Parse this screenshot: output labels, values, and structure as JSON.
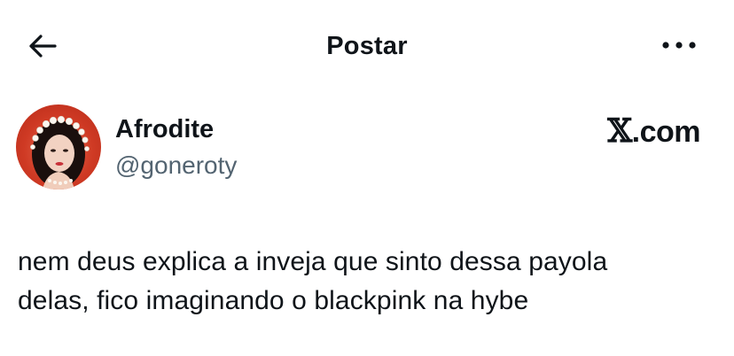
{
  "header": {
    "title": "Postar",
    "back_icon": "arrow-left-icon",
    "more_icon": "more-horizontal-icon"
  },
  "author": {
    "display_name": "Afrodite",
    "handle": "@goneroty",
    "avatar_icon": "avatar"
  },
  "brand": {
    "x_mark": "𝕏",
    "suffix": ".com"
  },
  "tweet": {
    "text": "nem deus explica a inveja que sinto dessa payola\ndelas, fico imaginando o blackpink na hybe"
  },
  "colors": {
    "text_primary": "#0f1419",
    "text_secondary": "#536471",
    "background": "#ffffff",
    "avatar_bg": "#cf3a24"
  }
}
